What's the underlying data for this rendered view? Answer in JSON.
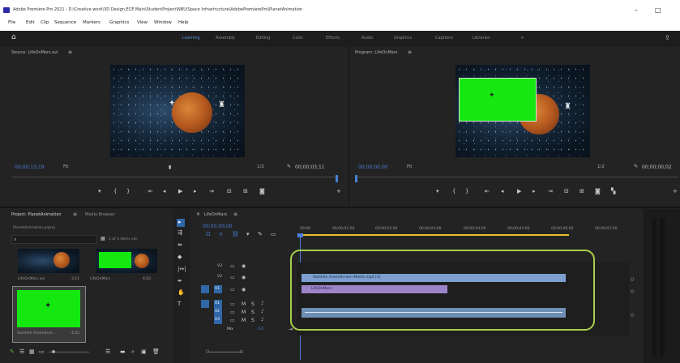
{
  "window": {
    "title": "Adobe Premiere Pro 2021 - D:\\Creative work\\3D Design,ECE Main\\StudentProject\\NBU\\Space Infrastructure\\AdobePremierePro\\PlanetAnimation",
    "minimize": "–",
    "maximize": "□"
  },
  "menu": [
    "File",
    "Edit",
    "Clip",
    "Sequence",
    "Markers",
    "Graphics",
    "View",
    "Window",
    "Help"
  ],
  "workspaces": [
    "Learning",
    "Assembly",
    "Editing",
    "Color",
    "Effects",
    "Audio",
    "Graphics",
    "Captions",
    "Libraries"
  ],
  "source": {
    "title": "Source: LifeOnMars.avi",
    "timecode": "00;00;13;19",
    "fit": "Fit",
    "quality": "1/2",
    "duration": "00;00;03;11"
  },
  "program": {
    "title": "Program: LifeOnMars",
    "timecode": "00;00;00;00",
    "fit": "Fit",
    "quality": "1/2",
    "duration": "00;00;00;02"
  },
  "project": {
    "tab_active": "Project: PlanetAnimation",
    "tab_other": "Media Browser",
    "file": "PlanetAnimation.prproj",
    "items_count": "1 of 3 items sel.",
    "items": [
      {
        "name": "LifeOnMars.avi",
        "duration": "3;11"
      },
      {
        "name": "LifeOnMars",
        "duration": "4;02"
      },
      {
        "name": "Satellite GreenScre...",
        "duration": "4;02"
      }
    ]
  },
  "timeline": {
    "tab": "LifeOnMars",
    "timecode": "00;00;00;00",
    "ruler": [
      "00;00",
      "00;00;01;00",
      "00;00;02;00",
      "00;00;03;00",
      "00;00;04;00",
      "00;00;05;00",
      "00;00;06;00",
      "00;00;07;00"
    ],
    "clip_v3": "Satellite GreenScreen-Mixkit.mp4 [V]",
    "clip_v2": "LifeOnMars",
    "mix_label": "Mix",
    "mix_value": "0.0",
    "track_labels": [
      "V3",
      "V2",
      "V1",
      "A1",
      "A2",
      "A3"
    ]
  }
}
